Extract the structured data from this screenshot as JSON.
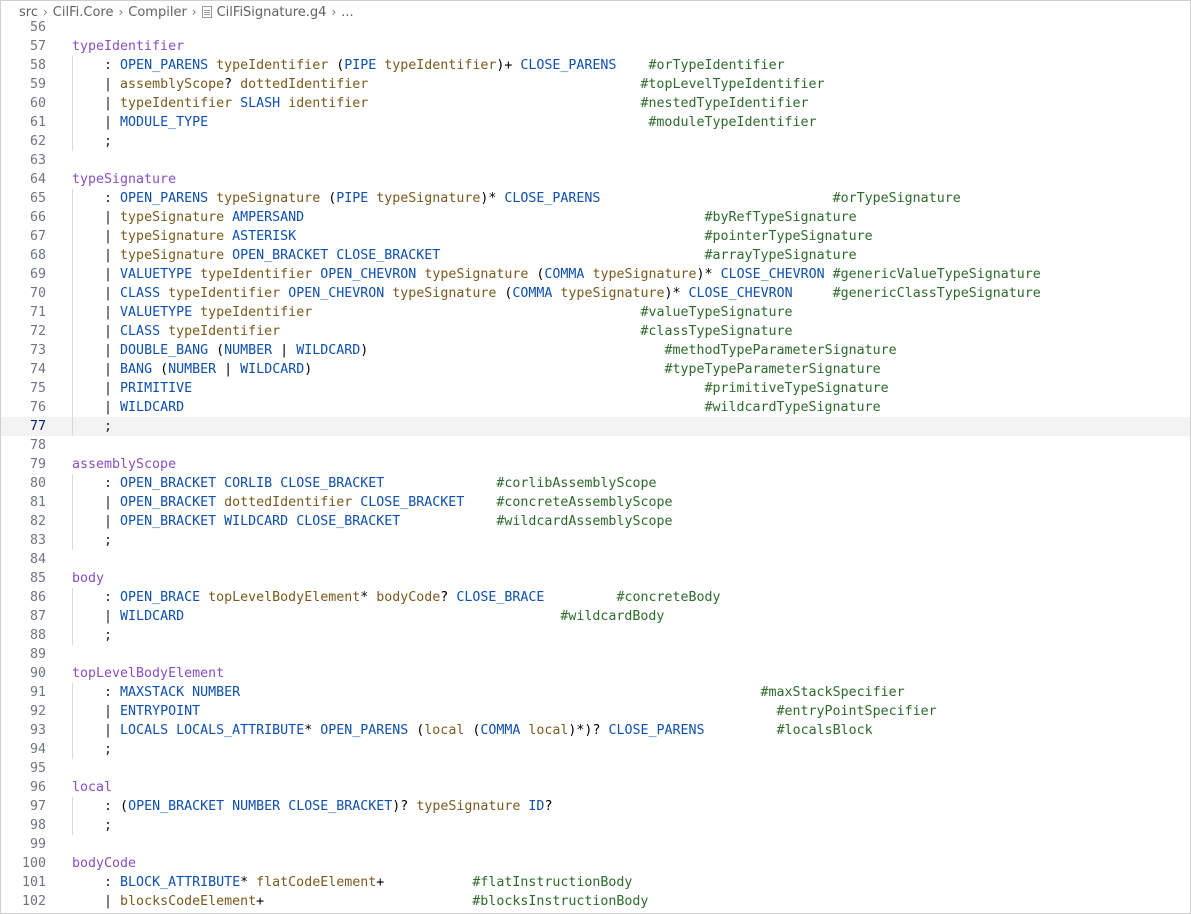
{
  "breadcrumb": {
    "items": [
      "src",
      "CilFi.Core",
      "Compiler",
      "CilFiSignature.g4",
      "..."
    ]
  },
  "editor": {
    "current_line": 77,
    "lines": [
      {
        "n": "56",
        "segs": []
      },
      {
        "n": "57",
        "segs": [
          {
            "t": "typeIdentifier",
            "c": "rule"
          }
        ]
      },
      {
        "n": "58",
        "segs": [
          {
            "t": "    : ",
            "c": "op"
          },
          {
            "t": "OPEN_PARENS",
            "c": "tok"
          },
          {
            "t": " "
          },
          {
            "t": "typeIdentifier",
            "c": "ref"
          },
          {
            "t": " ("
          },
          {
            "t": "PIPE",
            "c": "tok"
          },
          {
            "t": " "
          },
          {
            "t": "typeIdentifier",
            "c": "ref"
          },
          {
            "t": ")+ "
          },
          {
            "t": "CLOSE_PARENS",
            "c": "tok"
          },
          {
            "t": "    "
          },
          {
            "t": "#orTypeIdentifier",
            "c": "lbl"
          }
        ]
      },
      {
        "n": "59",
        "segs": [
          {
            "t": "    | ",
            "c": "op"
          },
          {
            "t": "assemblyScope",
            "c": "ref"
          },
          {
            "t": "? "
          },
          {
            "t": "dottedIdentifier",
            "c": "ref"
          },
          {
            "t": "                                  "
          },
          {
            "t": "#topLevelTypeIdentifier",
            "c": "lbl"
          }
        ]
      },
      {
        "n": "60",
        "segs": [
          {
            "t": "    | ",
            "c": "op"
          },
          {
            "t": "typeIdentifier",
            "c": "ref"
          },
          {
            "t": " "
          },
          {
            "t": "SLASH",
            "c": "tok"
          },
          {
            "t": " "
          },
          {
            "t": "identifier",
            "c": "ref"
          },
          {
            "t": "                                  "
          },
          {
            "t": "#nestedTypeIdentifier",
            "c": "lbl"
          }
        ]
      },
      {
        "n": "61",
        "segs": [
          {
            "t": "    | ",
            "c": "op"
          },
          {
            "t": "MODULE_TYPE",
            "c": "tok"
          },
          {
            "t": "                                                       "
          },
          {
            "t": "#moduleTypeIdentifier",
            "c": "lbl"
          }
        ]
      },
      {
        "n": "62",
        "segs": [
          {
            "t": "    ;",
            "c": "op"
          }
        ]
      },
      {
        "n": "63",
        "segs": []
      },
      {
        "n": "64",
        "segs": [
          {
            "t": "typeSignature",
            "c": "rule"
          }
        ]
      },
      {
        "n": "65",
        "segs": [
          {
            "t": "    : ",
            "c": "op"
          },
          {
            "t": "OPEN_PARENS",
            "c": "tok"
          },
          {
            "t": " "
          },
          {
            "t": "typeSignature",
            "c": "ref"
          },
          {
            "t": " ("
          },
          {
            "t": "PIPE",
            "c": "tok"
          },
          {
            "t": " "
          },
          {
            "t": "typeSignature",
            "c": "ref"
          },
          {
            "t": ")* "
          },
          {
            "t": "CLOSE_PARENS",
            "c": "tok"
          },
          {
            "t": "                             "
          },
          {
            "t": "#orTypeSignature",
            "c": "lbl"
          }
        ]
      },
      {
        "n": "66",
        "segs": [
          {
            "t": "    | ",
            "c": "op"
          },
          {
            "t": "typeSignature",
            "c": "ref"
          },
          {
            "t": " "
          },
          {
            "t": "AMPERSAND",
            "c": "tok"
          },
          {
            "t": "                                                  "
          },
          {
            "t": "#byRefTypeSignature",
            "c": "lbl"
          }
        ]
      },
      {
        "n": "67",
        "segs": [
          {
            "t": "    | ",
            "c": "op"
          },
          {
            "t": "typeSignature",
            "c": "ref"
          },
          {
            "t": " "
          },
          {
            "t": "ASTERISK",
            "c": "tok"
          },
          {
            "t": "                                                   "
          },
          {
            "t": "#pointerTypeSignature",
            "c": "lbl"
          }
        ]
      },
      {
        "n": "68",
        "segs": [
          {
            "t": "    | ",
            "c": "op"
          },
          {
            "t": "typeSignature",
            "c": "ref"
          },
          {
            "t": " "
          },
          {
            "t": "OPEN_BRACKET",
            "c": "tok"
          },
          {
            "t": " "
          },
          {
            "t": "CLOSE_BRACKET",
            "c": "tok"
          },
          {
            "t": "                                 "
          },
          {
            "t": "#arrayTypeSignature",
            "c": "lbl"
          }
        ]
      },
      {
        "n": "69",
        "segs": [
          {
            "t": "    | ",
            "c": "op"
          },
          {
            "t": "VALUETYPE",
            "c": "tok"
          },
          {
            "t": " "
          },
          {
            "t": "typeIdentifier",
            "c": "ref"
          },
          {
            "t": " "
          },
          {
            "t": "OPEN_CHEVRON",
            "c": "tok"
          },
          {
            "t": " "
          },
          {
            "t": "typeSignature",
            "c": "ref"
          },
          {
            "t": " ("
          },
          {
            "t": "COMMA",
            "c": "tok"
          },
          {
            "t": " "
          },
          {
            "t": "typeSignature",
            "c": "ref"
          },
          {
            "t": ")* "
          },
          {
            "t": "CLOSE_CHEVRON",
            "c": "tok"
          },
          {
            "t": " "
          },
          {
            "t": "#genericValueTypeSignature",
            "c": "lbl"
          }
        ]
      },
      {
        "n": "70",
        "segs": [
          {
            "t": "    | ",
            "c": "op"
          },
          {
            "t": "CLASS",
            "c": "tok"
          },
          {
            "t": " "
          },
          {
            "t": "typeIdentifier",
            "c": "ref"
          },
          {
            "t": " "
          },
          {
            "t": "OPEN_CHEVRON",
            "c": "tok"
          },
          {
            "t": " "
          },
          {
            "t": "typeSignature",
            "c": "ref"
          },
          {
            "t": " ("
          },
          {
            "t": "COMMA",
            "c": "tok"
          },
          {
            "t": " "
          },
          {
            "t": "typeSignature",
            "c": "ref"
          },
          {
            "t": ")* "
          },
          {
            "t": "CLOSE_CHEVRON",
            "c": "tok"
          },
          {
            "t": "     "
          },
          {
            "t": "#genericClassTypeSignature",
            "c": "lbl"
          }
        ]
      },
      {
        "n": "71",
        "segs": [
          {
            "t": "    | ",
            "c": "op"
          },
          {
            "t": "VALUETYPE",
            "c": "tok"
          },
          {
            "t": " "
          },
          {
            "t": "typeIdentifier",
            "c": "ref"
          },
          {
            "t": "                                         "
          },
          {
            "t": "#valueTypeSignature",
            "c": "lbl"
          }
        ]
      },
      {
        "n": "72",
        "segs": [
          {
            "t": "    | ",
            "c": "op"
          },
          {
            "t": "CLASS",
            "c": "tok"
          },
          {
            "t": " "
          },
          {
            "t": "typeIdentifier",
            "c": "ref"
          },
          {
            "t": "                                             "
          },
          {
            "t": "#classTypeSignature",
            "c": "lbl"
          }
        ]
      },
      {
        "n": "73",
        "segs": [
          {
            "t": "    | ",
            "c": "op"
          },
          {
            "t": "DOUBLE_BANG",
            "c": "tok"
          },
          {
            "t": " ("
          },
          {
            "t": "NUMBER",
            "c": "tok"
          },
          {
            "t": " | "
          },
          {
            "t": "WILDCARD",
            "c": "tok"
          },
          {
            "t": ")                                     "
          },
          {
            "t": "#methodTypeParameterSignature",
            "c": "lbl"
          }
        ]
      },
      {
        "n": "74",
        "segs": [
          {
            "t": "    | ",
            "c": "op"
          },
          {
            "t": "BANG",
            "c": "tok"
          },
          {
            "t": " ("
          },
          {
            "t": "NUMBER",
            "c": "tok"
          },
          {
            "t": " | "
          },
          {
            "t": "WILDCARD",
            "c": "tok"
          },
          {
            "t": ")                                            "
          },
          {
            "t": "#typeTypeParameterSignature",
            "c": "lbl"
          }
        ]
      },
      {
        "n": "75",
        "segs": [
          {
            "t": "    | ",
            "c": "op"
          },
          {
            "t": "PRIMITIVE",
            "c": "tok"
          },
          {
            "t": "                                                                "
          },
          {
            "t": "#primitiveTypeSignature",
            "c": "lbl"
          }
        ]
      },
      {
        "n": "76",
        "segs": [
          {
            "t": "    | ",
            "c": "op"
          },
          {
            "t": "WILDCARD",
            "c": "tok"
          },
          {
            "t": "                                                                 "
          },
          {
            "t": "#wildcardTypeSignature",
            "c": "lbl"
          }
        ]
      },
      {
        "n": "77",
        "segs": [
          {
            "t": "    ;",
            "c": "op"
          }
        ]
      },
      {
        "n": "78",
        "segs": []
      },
      {
        "n": "79",
        "segs": [
          {
            "t": "assemblyScope",
            "c": "rule"
          }
        ]
      },
      {
        "n": "80",
        "segs": [
          {
            "t": "    : ",
            "c": "op"
          },
          {
            "t": "OPEN_BRACKET",
            "c": "tok"
          },
          {
            "t": " "
          },
          {
            "t": "CORLIB",
            "c": "tok"
          },
          {
            "t": " "
          },
          {
            "t": "CLOSE_BRACKET",
            "c": "tok"
          },
          {
            "t": "              "
          },
          {
            "t": "#corlibAssemblyScope",
            "c": "lbl"
          }
        ]
      },
      {
        "n": "81",
        "segs": [
          {
            "t": "    | ",
            "c": "op"
          },
          {
            "t": "OPEN_BRACKET",
            "c": "tok"
          },
          {
            "t": " "
          },
          {
            "t": "dottedIdentifier",
            "c": "ref"
          },
          {
            "t": " "
          },
          {
            "t": "CLOSE_BRACKET",
            "c": "tok"
          },
          {
            "t": "    "
          },
          {
            "t": "#concreteAssemblyScope",
            "c": "lbl"
          }
        ]
      },
      {
        "n": "82",
        "segs": [
          {
            "t": "    | ",
            "c": "op"
          },
          {
            "t": "OPEN_BRACKET",
            "c": "tok"
          },
          {
            "t": " "
          },
          {
            "t": "WILDCARD",
            "c": "tok"
          },
          {
            "t": " "
          },
          {
            "t": "CLOSE_BRACKET",
            "c": "tok"
          },
          {
            "t": "            "
          },
          {
            "t": "#wildcardAssemblyScope",
            "c": "lbl"
          }
        ]
      },
      {
        "n": "83",
        "segs": [
          {
            "t": "    ;",
            "c": "op"
          }
        ]
      },
      {
        "n": "84",
        "segs": []
      },
      {
        "n": "85",
        "segs": [
          {
            "t": "body",
            "c": "rule"
          }
        ]
      },
      {
        "n": "86",
        "segs": [
          {
            "t": "    : ",
            "c": "op"
          },
          {
            "t": "OPEN_BRACE",
            "c": "tok"
          },
          {
            "t": " "
          },
          {
            "t": "topLevelBodyElement",
            "c": "ref"
          },
          {
            "t": "* "
          },
          {
            "t": "bodyCode",
            "c": "ref"
          },
          {
            "t": "? "
          },
          {
            "t": "CLOSE_BRACE",
            "c": "tok"
          },
          {
            "t": "         "
          },
          {
            "t": "#concreteBody",
            "c": "lbl"
          }
        ]
      },
      {
        "n": "87",
        "segs": [
          {
            "t": "    | ",
            "c": "op"
          },
          {
            "t": "WILDCARD",
            "c": "tok"
          },
          {
            "t": "                                               "
          },
          {
            "t": "#wildcardBody",
            "c": "lbl"
          }
        ]
      },
      {
        "n": "88",
        "segs": [
          {
            "t": "    ;",
            "c": "op"
          }
        ]
      },
      {
        "n": "89",
        "segs": []
      },
      {
        "n": "90",
        "segs": [
          {
            "t": "topLevelBodyElement",
            "c": "rule"
          }
        ]
      },
      {
        "n": "91",
        "segs": [
          {
            "t": "    : ",
            "c": "op"
          },
          {
            "t": "MAXSTACK",
            "c": "tok"
          },
          {
            "t": " "
          },
          {
            "t": "NUMBER",
            "c": "tok"
          },
          {
            "t": "                                                                 "
          },
          {
            "t": "#maxStackSpecifier",
            "c": "lbl"
          }
        ]
      },
      {
        "n": "92",
        "segs": [
          {
            "t": "    | ",
            "c": "op"
          },
          {
            "t": "ENTRYPOINT",
            "c": "tok"
          },
          {
            "t": "                                                                        "
          },
          {
            "t": "#entryPointSpecifier",
            "c": "lbl"
          }
        ]
      },
      {
        "n": "93",
        "segs": [
          {
            "t": "    | ",
            "c": "op"
          },
          {
            "t": "LOCALS",
            "c": "tok"
          },
          {
            "t": " "
          },
          {
            "t": "LOCALS_ATTRIBUTE",
            "c": "tok"
          },
          {
            "t": "* "
          },
          {
            "t": "OPEN_PARENS",
            "c": "tok"
          },
          {
            "t": " ("
          },
          {
            "t": "local",
            "c": "ref"
          },
          {
            "t": " ("
          },
          {
            "t": "COMMA",
            "c": "tok"
          },
          {
            "t": " "
          },
          {
            "t": "local",
            "c": "ref"
          },
          {
            "t": ")*)? "
          },
          {
            "t": "CLOSE_PARENS",
            "c": "tok"
          },
          {
            "t": "         "
          },
          {
            "t": "#localsBlock",
            "c": "lbl"
          }
        ]
      },
      {
        "n": "94",
        "segs": [
          {
            "t": "    ;",
            "c": "op"
          }
        ]
      },
      {
        "n": "95",
        "segs": []
      },
      {
        "n": "96",
        "segs": [
          {
            "t": "local",
            "c": "rule"
          }
        ]
      },
      {
        "n": "97",
        "segs": [
          {
            "t": "    : ",
            "c": "op"
          },
          {
            "t": "("
          },
          {
            "t": "OPEN_BRACKET",
            "c": "tok"
          },
          {
            "t": " "
          },
          {
            "t": "NUMBER",
            "c": "tok"
          },
          {
            "t": " "
          },
          {
            "t": "CLOSE_BRACKET",
            "c": "tok"
          },
          {
            "t": ")? "
          },
          {
            "t": "typeSignature",
            "c": "ref"
          },
          {
            "t": " "
          },
          {
            "t": "ID",
            "c": "tok"
          },
          {
            "t": "?"
          }
        ]
      },
      {
        "n": "98",
        "segs": [
          {
            "t": "    ;",
            "c": "op"
          }
        ]
      },
      {
        "n": "99",
        "segs": []
      },
      {
        "n": "100",
        "segs": [
          {
            "t": "bodyCode",
            "c": "rule"
          }
        ]
      },
      {
        "n": "101",
        "segs": [
          {
            "t": "    : ",
            "c": "op"
          },
          {
            "t": "BLOCK_ATTRIBUTE",
            "c": "tok"
          },
          {
            "t": "* "
          },
          {
            "t": "flatCodeElement",
            "c": "ref"
          },
          {
            "t": "+           "
          },
          {
            "t": "#flatInstructionBody",
            "c": "lbl"
          }
        ]
      },
      {
        "n": "102",
        "segs": [
          {
            "t": "    | ",
            "c": "op"
          },
          {
            "t": "blocksCodeElement",
            "c": "ref"
          },
          {
            "t": "+                          "
          },
          {
            "t": "#blocksInstructionBody",
            "c": "lbl"
          }
        ]
      }
    ]
  }
}
